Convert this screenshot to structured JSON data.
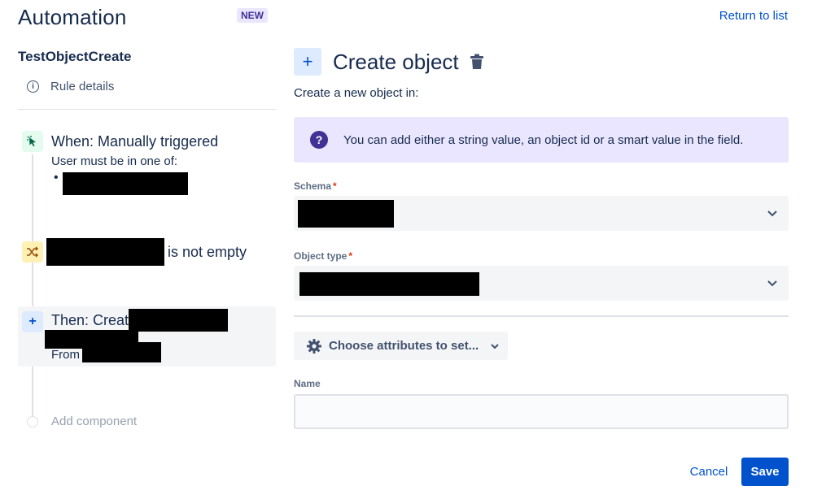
{
  "header": {
    "title": "Automation",
    "badge": "NEW",
    "return_link": "Return to list"
  },
  "sidebar": {
    "rule_name": "TestObjectCreate",
    "rule_details": "Rule details",
    "trigger": {
      "title": "When: Manually triggered",
      "subtitle": "User must be in one of:",
      "bullet": "•"
    },
    "condition": {
      "text": "is not empty"
    },
    "action": {
      "title": "Then: Create",
      "from_label": "From"
    },
    "add_component": "Add component"
  },
  "main": {
    "title": "Create object",
    "subtitle": "Create a new object in:",
    "info_banner": "You can add either a string value, an object id or a smart value in the field.",
    "schema_label": "Schema",
    "object_type_label": "Object type",
    "required_mark": "*",
    "attributes_button": "Choose attributes to set...",
    "name_label": "Name",
    "name_value": ""
  },
  "footer": {
    "cancel": "Cancel",
    "save": "Save"
  },
  "icons": {
    "info": "info-icon",
    "trigger": "cursor-click-icon",
    "condition": "shuffle-icon",
    "action": "plus-icon",
    "trash": "trash-icon",
    "question": "question-icon",
    "gear": "gear-icon",
    "chevron": "chevron-down-icon"
  },
  "colors": {
    "accent": "#0052cc",
    "banner_bg": "#eae6ff",
    "trigger_bg": "#e3fcef",
    "condition_bg": "#fff0b3",
    "action_bg": "#deebff"
  }
}
